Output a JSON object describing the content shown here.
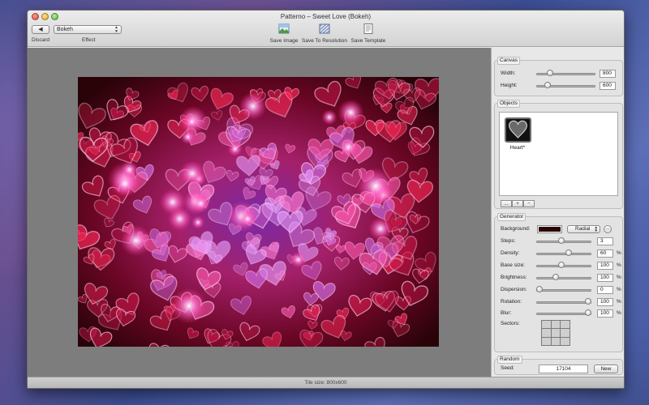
{
  "window": {
    "title": "Patterno – Sweet Love (Bokeh)"
  },
  "toolbar": {
    "back_label": "◀",
    "discard_label": "Discard",
    "effect_value": "Bokeh",
    "effect_label": "Effect",
    "save_image": "Save Image",
    "save_resolution": "Save To Resolution",
    "save_template": "Save Template"
  },
  "canvas": {
    "title": "Canvas",
    "width_label": "Width:",
    "width_value": "800",
    "width_fraction": 0.2,
    "height_label": "Height:",
    "height_value": "600",
    "height_fraction": 0.15
  },
  "objects": {
    "title": "Objects",
    "items": [
      {
        "label": "Heart*"
      }
    ],
    "buttons": [
      "...",
      "+",
      "−"
    ]
  },
  "generator": {
    "title": "Generator",
    "background_label": "Background:",
    "background_color": "#2a0508",
    "background_mode": "Radial",
    "rows": [
      {
        "label": "Steps:",
        "value": "3",
        "fraction": 0.45,
        "pct": ""
      },
      {
        "label": "Density:",
        "value": "60",
        "fraction": 0.6,
        "pct": "%"
      },
      {
        "label": "Base size:",
        "value": "100",
        "fraction": 0.45,
        "pct": "%"
      },
      {
        "label": "Brightness:",
        "value": "100",
        "fraction": 0.33,
        "pct": "%"
      },
      {
        "label": "Dispersion:",
        "value": "0",
        "fraction": 0.0,
        "pct": "%"
      },
      {
        "label": "Rotation:",
        "value": "100",
        "fraction": 1.0,
        "pct": "%"
      },
      {
        "label": "Blur:",
        "value": "100",
        "fraction": 1.0,
        "pct": "%"
      }
    ],
    "sectors_label": "Sectors:"
  },
  "random": {
    "title": "Random",
    "seed_label": "Seed:",
    "seed_value": "17104",
    "new_label": "New"
  },
  "status": {
    "tile_size": "Tile size: 800x600"
  },
  "colors": {
    "image_bg": "#3a0415",
    "accent_pink": "#ff4fa0",
    "accent_red": "#e01030"
  }
}
